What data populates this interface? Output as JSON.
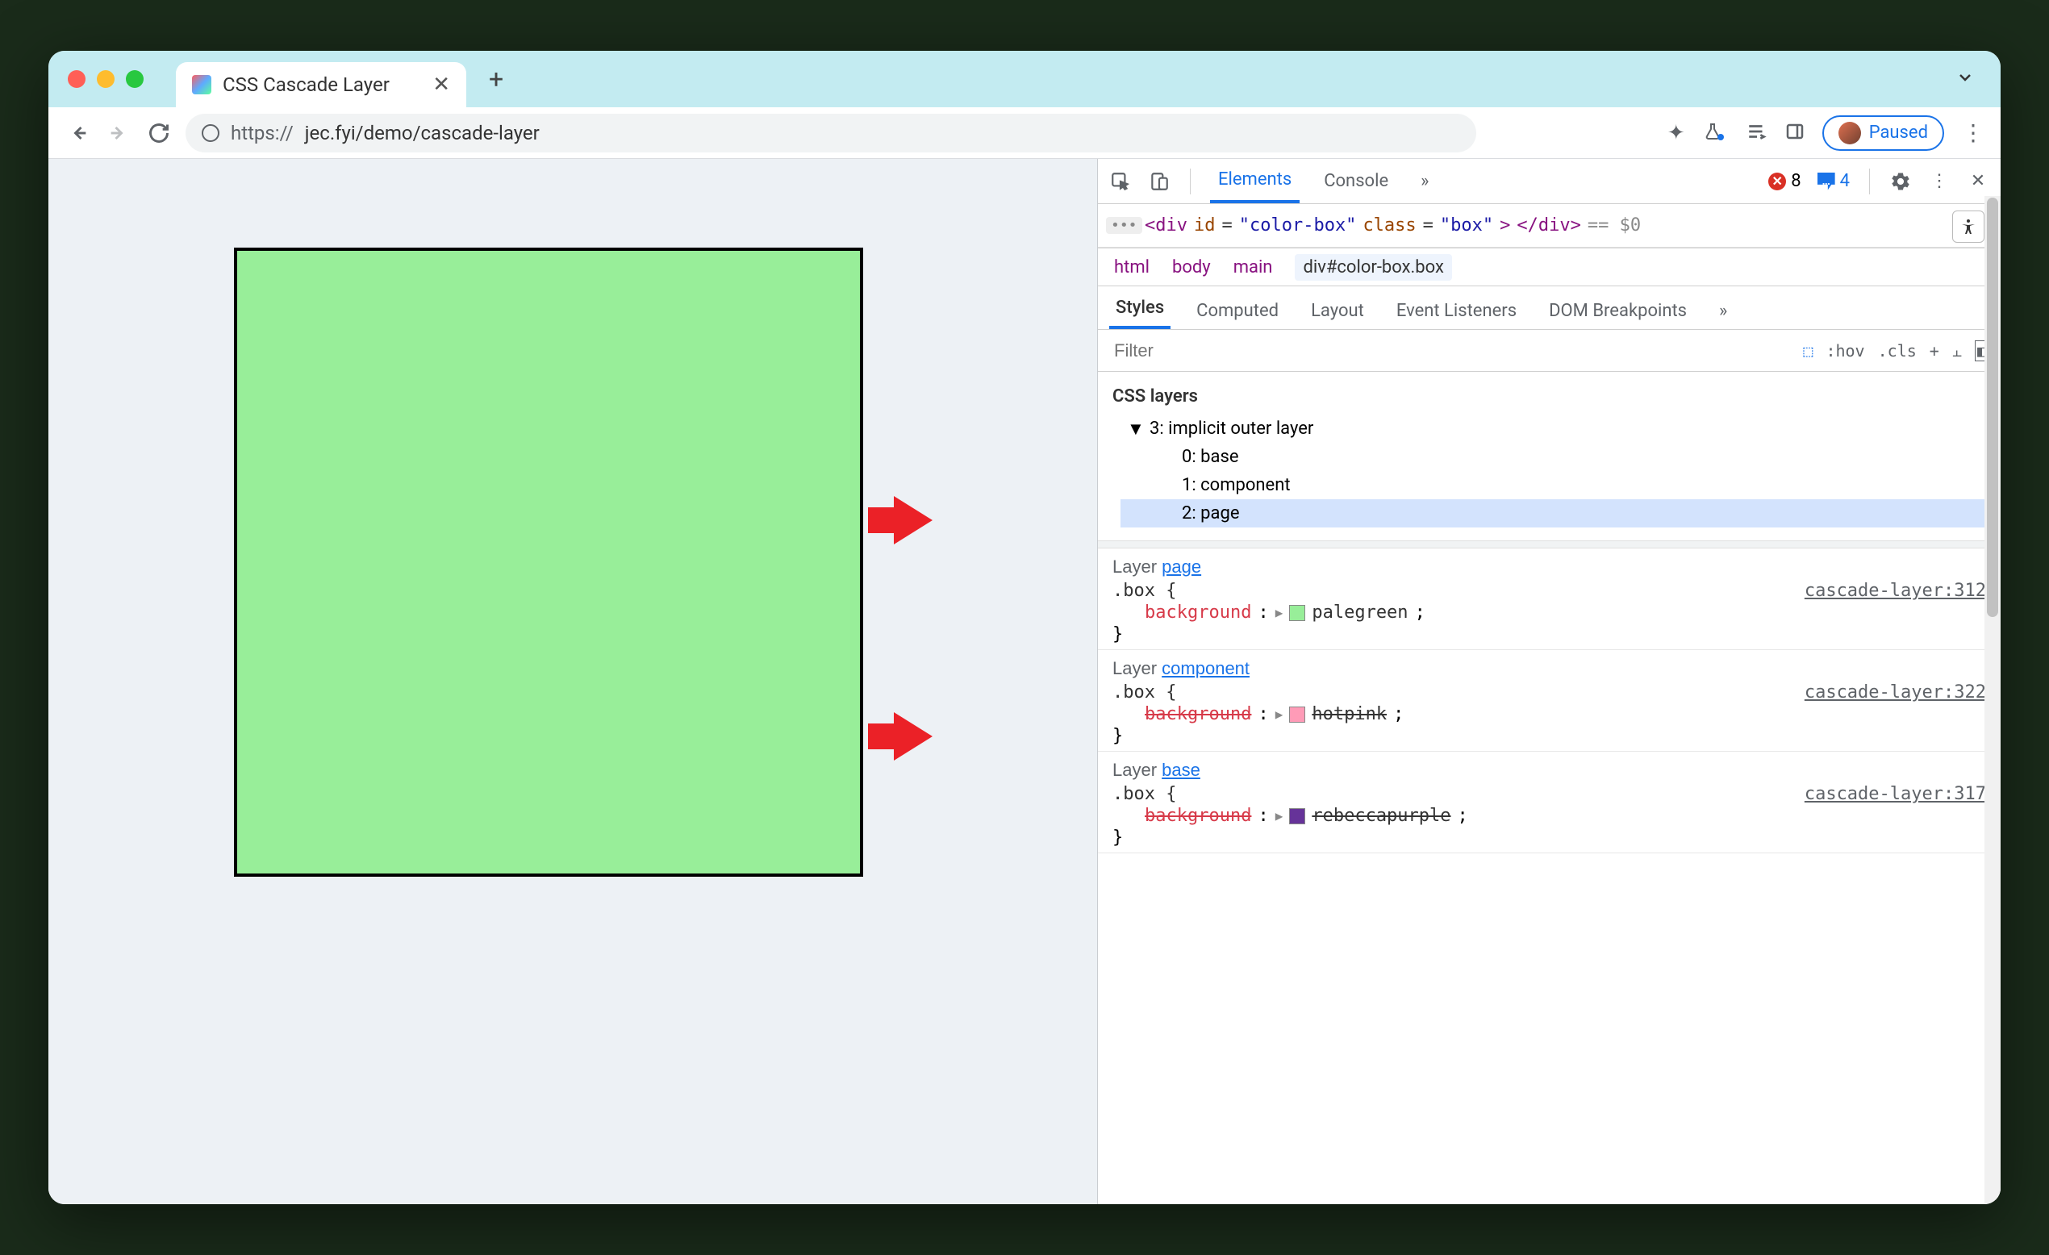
{
  "tab": {
    "title": "CSS Cascade Layer"
  },
  "url": {
    "scheme": "https://",
    "rest": "jec.fyi/demo/cascade-layer"
  },
  "paused": {
    "label": "Paused"
  },
  "devtools": {
    "tabs": {
      "elements": "Elements",
      "console": "Console"
    },
    "errors": "8",
    "messages": "4",
    "dom_line": "<div id=\"color-box\" class=\"box\"> </div>",
    "dollar": "== $0",
    "breadcrumb": {
      "html": "html",
      "body": "body",
      "main": "main",
      "sel": "div#color-box.box"
    },
    "styles_tabs": {
      "styles": "Styles",
      "computed": "Computed",
      "layout": "Layout",
      "events": "Event Listeners",
      "dom_bp": "DOM Breakpoints"
    },
    "filter_placeholder": "Filter",
    "toolbar_items": {
      "hov": ":hov",
      "cls": ".cls"
    },
    "css_layers": {
      "title": "CSS layers",
      "root": "3: implicit outer layer",
      "items": [
        "0: base",
        "1: component",
        "2: page"
      ]
    },
    "rules": [
      {
        "layer_label": "Layer",
        "layer_link": "page",
        "selector": ".box {",
        "source": "cascade-layer:312",
        "prop": "background",
        "value": "palegreen",
        "swatch": "#98ee99",
        "strike": false
      },
      {
        "layer_label": "Layer",
        "layer_link": "component",
        "selector": ".box {",
        "source": "cascade-layer:322",
        "prop": "background",
        "value": "hotpink",
        "swatch": "#ff9bb7",
        "strike": true
      },
      {
        "layer_label": "Layer",
        "layer_link": "base",
        "selector": ".box {",
        "source": "cascade-layer:317",
        "prop": "background",
        "value": "rebeccapurple",
        "swatch": "#663399",
        "strike": true
      }
    ],
    "close_brace": "}"
  }
}
